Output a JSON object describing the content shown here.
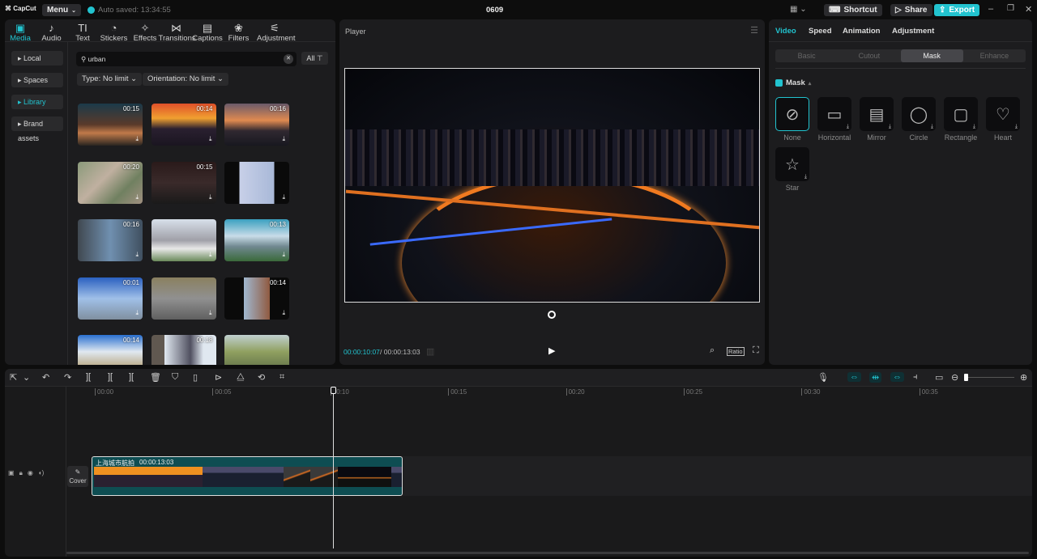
{
  "topbar": {
    "logo": "CapCut",
    "menu": "Menu",
    "autosave": "Auto saved: 13:34:55",
    "project": "0609",
    "shortcut": "Shortcut",
    "share": "Share",
    "export": "Export"
  },
  "tabs": [
    {
      "label": "Media",
      "icon": "▣"
    },
    {
      "label": "Audio",
      "icon": "♪"
    },
    {
      "label": "Text",
      "icon": "TI"
    },
    {
      "label": "Stickers",
      "icon": "◔"
    },
    {
      "label": "Effects",
      "icon": "✧"
    },
    {
      "label": "Transitions",
      "icon": "⋈"
    },
    {
      "label": "Captions",
      "icon": "▤"
    },
    {
      "label": "Filters",
      "icon": "❀"
    },
    {
      "label": "Adjustment",
      "icon": "⚟"
    }
  ],
  "sidebar": [
    "Local",
    "Spaces",
    "Library",
    "Brand assets"
  ],
  "search": {
    "value": "urban",
    "all": "All"
  },
  "filters": {
    "type": "Type: No limit",
    "orientation": "Orientation: No limit"
  },
  "media": [
    {
      "dur": "00:15",
      "bg": "linear-gradient(180deg,#1b3a4a,#5a3a2a 50%,#c07a4a 70%,#2a2520)"
    },
    {
      "dur": "00:14",
      "bg": "linear-gradient(180deg,#e0502a,#f0a030 35%,#2a2030 60%,#1a1520)"
    },
    {
      "dur": "00:16",
      "bg": "linear-gradient(180deg,#6a5a6a,#e08a50 40%,#302830 65%,#181820)"
    },
    {
      "dur": "00:20",
      "bg": "linear-gradient(135deg,#8a9a7a,#c0b0a0 40%,#708060 70%,#a09080)"
    },
    {
      "dur": "00:15",
      "bg": "linear-gradient(180deg,#2a1a1a,#3a2a2a 50%,#1a1a1a)"
    },
    {
      "dur": "",
      "bg": "linear-gradient(90deg,#0a0a0a 23%,#c8d0e8 23%,#a8b8d8 77%,#0a0a0a 77%)"
    },
    {
      "dur": "00:16",
      "bg": "linear-gradient(90deg,#404850,#7090b0 50%,#405060)"
    },
    {
      "dur": "",
      "bg": "linear-gradient(180deg,#d8e0ea,#a0a0a8 50%,#e8e8e8 70%,#6a8a5a)"
    },
    {
      "dur": "00:13",
      "bg": "linear-gradient(180deg,#3aa0c0,#c8dce8 40%,#708890 65%,#3a6a3a)"
    },
    {
      "dur": "00:01",
      "bg": "linear-gradient(180deg,#2a60c0,#a0c0e8 50%,#8090a0)"
    },
    {
      "dur": "",
      "bg": "linear-gradient(180deg,#8a8060,#909090 50%,#606060)"
    },
    {
      "dur": "00:14",
      "bg": "linear-gradient(90deg,#0a0a0a 30%,#a0b8d0 30%,#905a40 70%,#0a0a0a 70%)"
    },
    {
      "dur": "00:14",
      "bg": "linear-gradient(180deg,#2a70d0,#e0e8f0 40%,#a08040)"
    },
    {
      "dur": "00:18",
      "bg": "linear-gradient(90deg,#605850 20%,#e0e8f0 20%,#505060 60%,#e0e8f0 80%)"
    },
    {
      "dur": "",
      "bg": "linear-gradient(180deg,#c0d0d0,#90a060 40%,#506040)"
    }
  ],
  "player": {
    "title": "Player",
    "current": "00:00:10:07",
    "total": "00:00:13:03",
    "ratio": "Ratio"
  },
  "right": {
    "tabs": [
      "Video",
      "Speed",
      "Animation",
      "Adjustment"
    ],
    "subtabs": [
      "Basic",
      "Cutout",
      "Mask",
      "Enhance"
    ],
    "mask_label": "Mask",
    "masks": [
      {
        "label": "None",
        "icon": "⊘"
      },
      {
        "label": "Horizontal",
        "icon": "▭"
      },
      {
        "label": "Mirror",
        "icon": "▤"
      },
      {
        "label": "Circle",
        "icon": "◯"
      },
      {
        "label": "Rectangle",
        "icon": "▢"
      },
      {
        "label": "Heart",
        "icon": "♡"
      },
      {
        "label": "Star",
        "icon": "☆"
      }
    ]
  },
  "timeline": {
    "ruler": [
      "00:00",
      "00:05",
      "00:10",
      "00:15",
      "00:20",
      "00:25",
      "00:30",
      "00:35"
    ],
    "clip_title": "上海城市航拍",
    "clip_dur": "00:00:13:03",
    "cover": "Cover"
  },
  "colors": {
    "accent": "#22c3cf",
    "clip": "#0e4d52"
  }
}
